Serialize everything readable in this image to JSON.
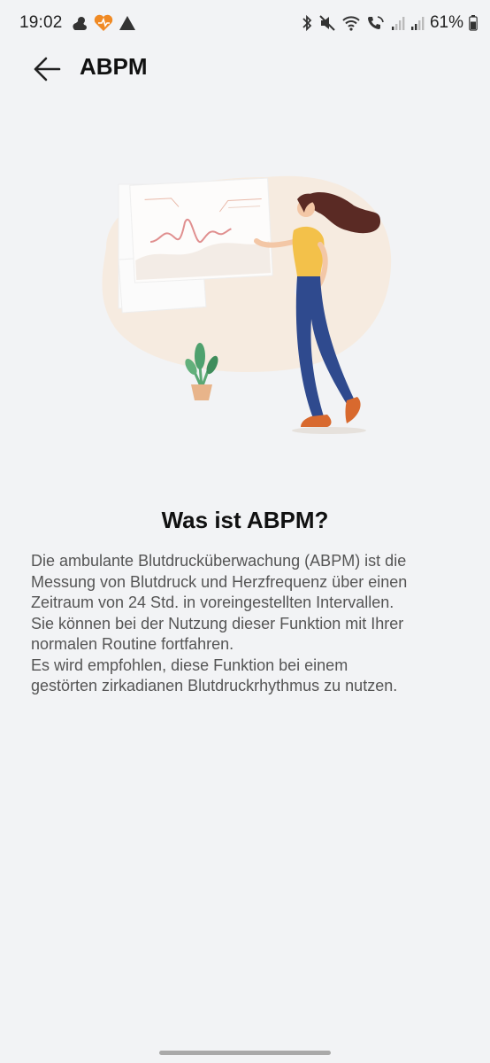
{
  "status_bar": {
    "time": "19:02",
    "battery_percent": "61%",
    "left_icons": [
      "weather-icon",
      "health-app-icon",
      "navigation-arrow-icon"
    ],
    "right_icons": [
      "bluetooth-icon",
      "mute-icon",
      "wifi-icon",
      "wifi-call-icon",
      "signal-icon",
      "signal-icon",
      "battery-icon"
    ]
  },
  "app_bar": {
    "title": "ABPM",
    "back_icon": "arrow-left-icon"
  },
  "content": {
    "heading": "Was ist ABPM?",
    "description_lines": [
      "Die ambulante Blutdrucküberwachung (ABPM) ist die",
      "Messung von Blutdruck und Herzfrequenz über einen",
      "Zeitraum von 24 Std. in voreingestellten Intervallen.",
      "Sie können bei der Nutzung dieser Funktion mit Ihrer",
      "normalen Routine fortfahren.",
      "Es wird empfohlen, diese Funktion bei einem",
      "gestörten zirkadianen Blutdruckrhythmus zu nutzen."
    ]
  },
  "colors": {
    "background": "#f2f3f5",
    "accent_orange": "#f08a24",
    "text_primary": "#111111",
    "text_secondary": "#555555"
  }
}
